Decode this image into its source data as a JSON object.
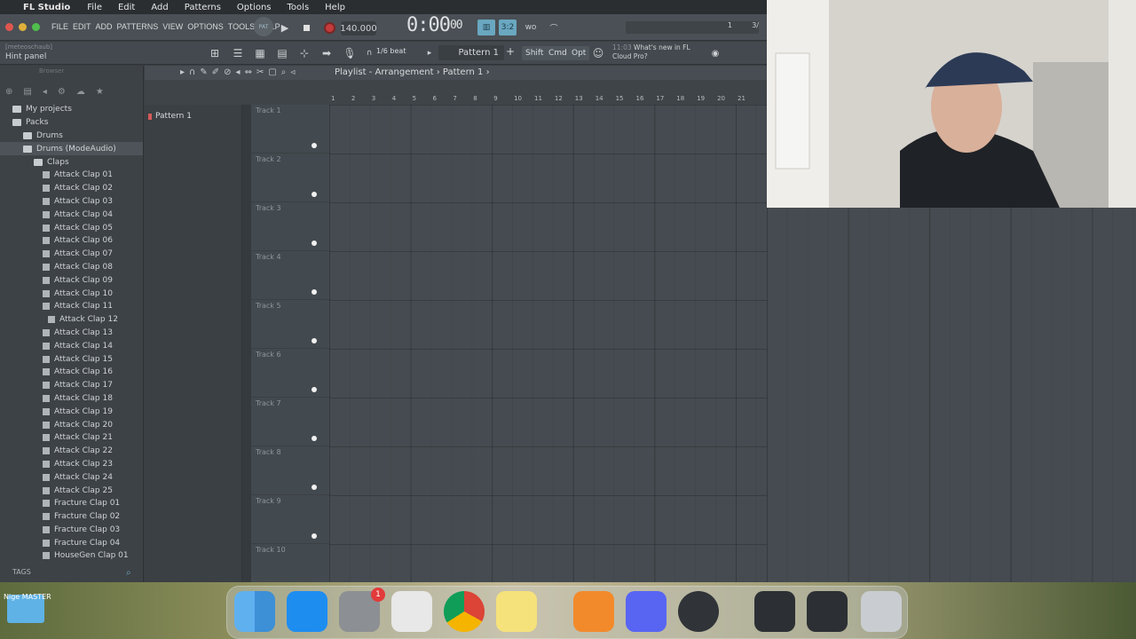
{
  "mac_menu": {
    "app": "FL Studio",
    "items": [
      "File",
      "Edit",
      "Add",
      "Patterns",
      "Options",
      "Tools",
      "Help"
    ]
  },
  "fl_menu": [
    "FILE",
    "EDIT",
    "ADD",
    "PATTERNS",
    "VIEW",
    "OPTIONS",
    "TOOLS",
    "HELP"
  ],
  "transport": {
    "mode": "PAT",
    "tempo": "140.000",
    "time": "0:00",
    "time_small": "00",
    "snap": "1/6 beat",
    "pattern": "Pattern 1",
    "counter": "1",
    "counter2": "3/"
  },
  "hint": {
    "sub": "[meteoschaub]",
    "text": "Hint panel"
  },
  "modifiers": [
    "Shift",
    "Cmd",
    "Opt"
  ],
  "news": {
    "time": "11:03",
    "line1": "What's new in FL",
    "line2": "Cloud Pro?"
  },
  "browser": {
    "head": "Browser",
    "tree": [
      {
        "label": "My projects",
        "indent": 14,
        "type": "folder"
      },
      {
        "label": "Packs",
        "indent": 14,
        "type": "folder"
      },
      {
        "label": "Drums",
        "indent": 26,
        "type": "folder"
      },
      {
        "label": "Drums (ModeAudio)",
        "indent": 26,
        "type": "folder"
      },
      {
        "label": "Claps",
        "indent": 38,
        "type": "folder"
      },
      {
        "label": "Attack Clap 01",
        "indent": 48,
        "type": "wave"
      },
      {
        "label": "Attack Clap 02",
        "indent": 48,
        "type": "wave"
      },
      {
        "label": "Attack Clap 03",
        "indent": 48,
        "type": "wave"
      },
      {
        "label": "Attack Clap 04",
        "indent": 48,
        "type": "wave"
      },
      {
        "label": "Attack Clap 05",
        "indent": 48,
        "type": "wave"
      },
      {
        "label": "Attack Clap 06",
        "indent": 48,
        "type": "wave"
      },
      {
        "label": "Attack Clap 07",
        "indent": 48,
        "type": "wave"
      },
      {
        "label": "Attack Clap 08",
        "indent": 48,
        "type": "wave"
      },
      {
        "label": "Attack Clap 09",
        "indent": 48,
        "type": "wave"
      },
      {
        "label": "Attack Clap 10",
        "indent": 48,
        "type": "wave"
      },
      {
        "label": "Attack Clap 11",
        "indent": 48,
        "type": "wave"
      },
      {
        "label": "Attack Clap 12",
        "indent": 54,
        "type": "wave"
      },
      {
        "label": "Attack Clap 13",
        "indent": 48,
        "type": "wave"
      },
      {
        "label": "Attack Clap 14",
        "indent": 48,
        "type": "wave"
      },
      {
        "label": "Attack Clap 15",
        "indent": 48,
        "type": "wave"
      },
      {
        "label": "Attack Clap 16",
        "indent": 48,
        "type": "wave"
      },
      {
        "label": "Attack Clap 17",
        "indent": 48,
        "type": "wave"
      },
      {
        "label": "Attack Clap 18",
        "indent": 48,
        "type": "wave"
      },
      {
        "label": "Attack Clap 19",
        "indent": 48,
        "type": "wave"
      },
      {
        "label": "Attack Clap 20",
        "indent": 48,
        "type": "wave"
      },
      {
        "label": "Attack Clap 21",
        "indent": 48,
        "type": "wave"
      },
      {
        "label": "Attack Clap 22",
        "indent": 48,
        "type": "wave"
      },
      {
        "label": "Attack Clap 23",
        "indent": 48,
        "type": "wave"
      },
      {
        "label": "Attack Clap 24",
        "indent": 48,
        "type": "wave"
      },
      {
        "label": "Attack Clap 25",
        "indent": 48,
        "type": "wave"
      },
      {
        "label": "Fracture Clap 01",
        "indent": 48,
        "type": "wave"
      },
      {
        "label": "Fracture Clap 02",
        "indent": 48,
        "type": "wave"
      },
      {
        "label": "Fracture Clap 03",
        "indent": 48,
        "type": "wave"
      },
      {
        "label": "Fracture Clap 04",
        "indent": 48,
        "type": "wave"
      },
      {
        "label": "HouseGen Clap 01",
        "indent": 48,
        "type": "wave"
      }
    ],
    "tags": "TAGS"
  },
  "playlist": {
    "title": "Playlist - Arrangement",
    "crumb": "Pattern 1",
    "pattern_item": "Pattern 1",
    "tracks": [
      "Track 1",
      "Track 2",
      "Track 3",
      "Track 4",
      "Track 5",
      "Track 6",
      "Track 7",
      "Track 8",
      "Track 9",
      "Track 10"
    ],
    "bars": [
      "1",
      "2",
      "3",
      "4",
      "5",
      "6",
      "7",
      "8",
      "9",
      "10",
      "11",
      "12",
      "13",
      "14",
      "15",
      "16",
      "17",
      "18",
      "19",
      "20",
      "21"
    ]
  },
  "desktop": {
    "label": "Nige MASTER",
    "notification": "1"
  },
  "colors": {
    "accent": "#6aa7c0",
    "record": "#c43b3b",
    "background": "#3b4044"
  }
}
